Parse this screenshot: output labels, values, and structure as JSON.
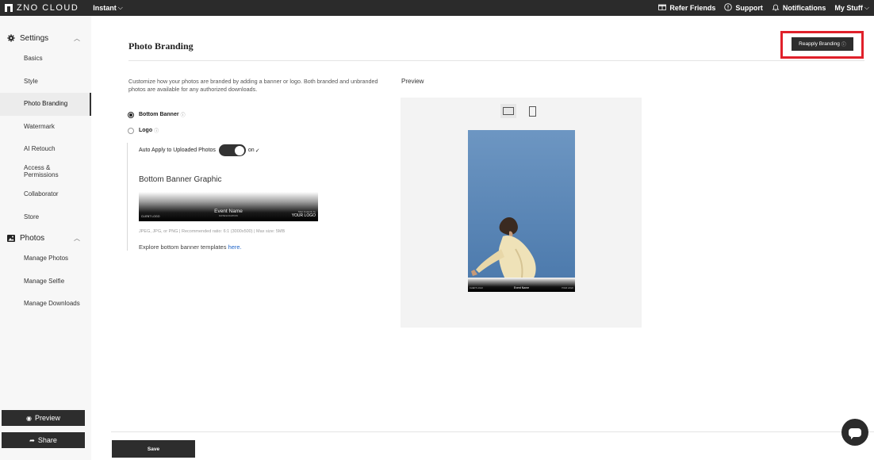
{
  "topbar": {
    "logo_text": "ZNO CLOUD",
    "product": "Instant",
    "links": {
      "refer": "Refer Friends",
      "support": "Support",
      "notifications": "Notifications",
      "mystuff": "My Stuff"
    }
  },
  "sidebar": {
    "settings_label": "Settings",
    "settings_items": [
      "Basics",
      "Style",
      "Photo Branding",
      "Watermark",
      "AI Retouch",
      "Access & Permissions",
      "Collaborator",
      "Store"
    ],
    "active_item": "Photo Branding",
    "photos_label": "Photos",
    "photos_items": [
      "Manage Photos",
      "Manage Selfie",
      "Manage Downloads"
    ],
    "preview_button": "Preview",
    "share_button": "Share"
  },
  "main": {
    "title": "Photo Branding",
    "reapply_button": "Reapply Branding",
    "description": "Customize how your photos are branded by adding a banner or logo. Both branded and unbranded photos are available for any authorized downloads.",
    "options": {
      "bottom_banner": "Bottom Banner",
      "logo": "Logo",
      "selected": "Bottom Banner"
    },
    "auto_apply": {
      "label": "Auto Apply to Uploaded Photos",
      "state": "on",
      "checkmark": "✓"
    },
    "graphic_title": "Bottom Banner Graphic",
    "banner": {
      "left": "CLIENT LOGO",
      "event": "Event Name",
      "location": "DATE/LOCATION",
      "right_small": "Shot Instantly by",
      "right_large": "YOUR LOGO"
    },
    "hint": "JPEG, JPG, or PNG | Recommended ratio: 6:1 (3000x500) | Max size: 5MB",
    "explore_text": "Explore bottom banner templates",
    "explore_link": "here.",
    "preview_label": "Preview",
    "save_button": "Save"
  },
  "colors": {
    "accent_dark": "#2d2d2d",
    "highlight_red": "#e0202a",
    "link_blue": "#2467c8",
    "sky_blue": "#5a85b6"
  }
}
